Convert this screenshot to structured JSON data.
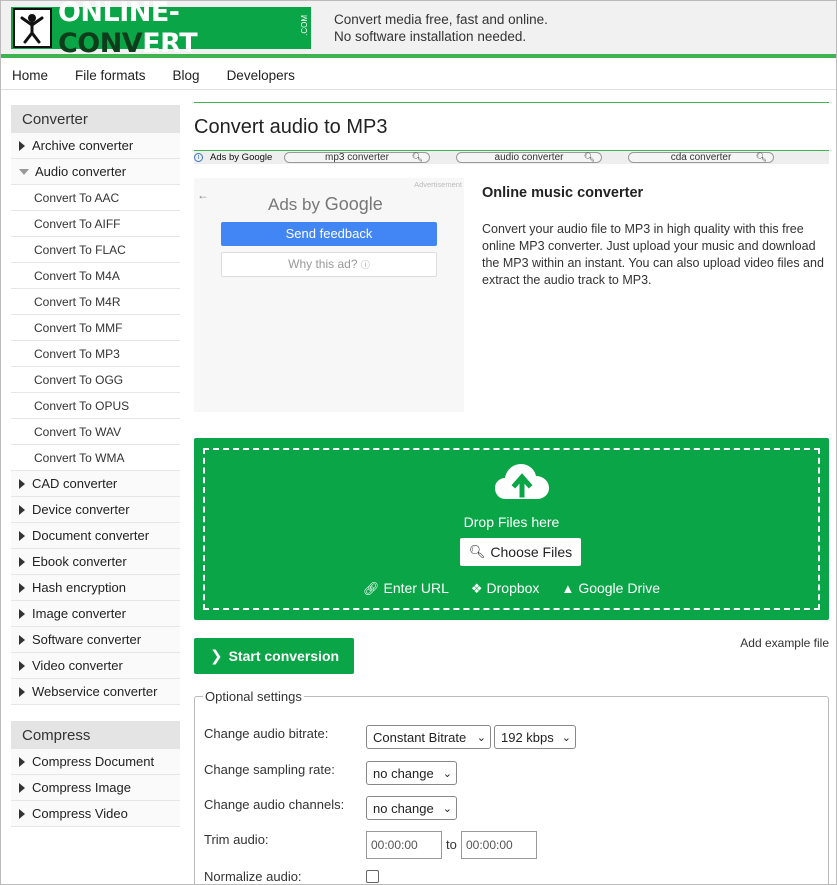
{
  "header": {
    "logo_main": "ONLINE-",
    "logo_dark": "CONV",
    "logo_end": "ERT",
    "logo_com": ".COM",
    "tagline_1": "Convert media free, fast and online.",
    "tagline_2": "No software installation needed.",
    "brand_color": "#0aa547"
  },
  "nav": [
    "Home",
    "File formats",
    "Blog",
    "Developers"
  ],
  "sidebar": {
    "converter_title": "Converter",
    "archive": "Archive converter",
    "audio": "Audio converter",
    "audio_sub": [
      "Convert To AAC",
      "Convert To AIFF",
      "Convert To FLAC",
      "Convert To M4A",
      "Convert To M4R",
      "Convert To MMF",
      "Convert To MP3",
      "Convert To OGG",
      "Convert To OPUS",
      "Convert To WAV",
      "Convert To WMA"
    ],
    "others": [
      "CAD converter",
      "Device converter",
      "Document converter",
      "Ebook converter",
      "Hash encryption",
      "Image converter",
      "Software converter",
      "Video converter",
      "Webservice converter"
    ],
    "compress_title": "Compress",
    "compress": [
      "Compress Document",
      "Compress Image",
      "Compress Video"
    ]
  },
  "main": {
    "title": "Convert audio to MP3",
    "ads_label": "Ads by Google",
    "ad_pills": [
      "mp3 converter",
      "audio converter",
      "cda converter"
    ],
    "ad": {
      "advertisement": "Advertisement",
      "ads_by": "Ads by",
      "google": "Google",
      "feedback": "Send feedback",
      "why": "Why this ad?"
    },
    "info_heading": "Online music converter",
    "info_text": "Convert your audio file to MP3 in high quality with this free online MP3 converter. Just upload your music and download the MP3 within an instant. You can also upload video files and extract the audio track to MP3.",
    "drop_text": "Drop Files here",
    "choose_files": "Choose Files",
    "enter_url": "Enter URL",
    "dropbox": "Dropbox",
    "google_drive": "Google Drive",
    "start": "Start conversion",
    "example": "Add example file"
  },
  "options": {
    "legend": "Optional settings",
    "bitrate_label": "Change audio bitrate:",
    "bitrate_mode": "Constant Bitrate",
    "bitrate_value": "192 kbps",
    "sampling_label": "Change sampling rate:",
    "sampling_value": "no change",
    "channels_label": "Change audio channels:",
    "channels_value": "no change",
    "trim_label": "Trim audio:",
    "trim_from": "00:00:00",
    "trim_to_word": "to",
    "trim_to": "00:00:00",
    "normalize_label": "Normalize audio:"
  }
}
